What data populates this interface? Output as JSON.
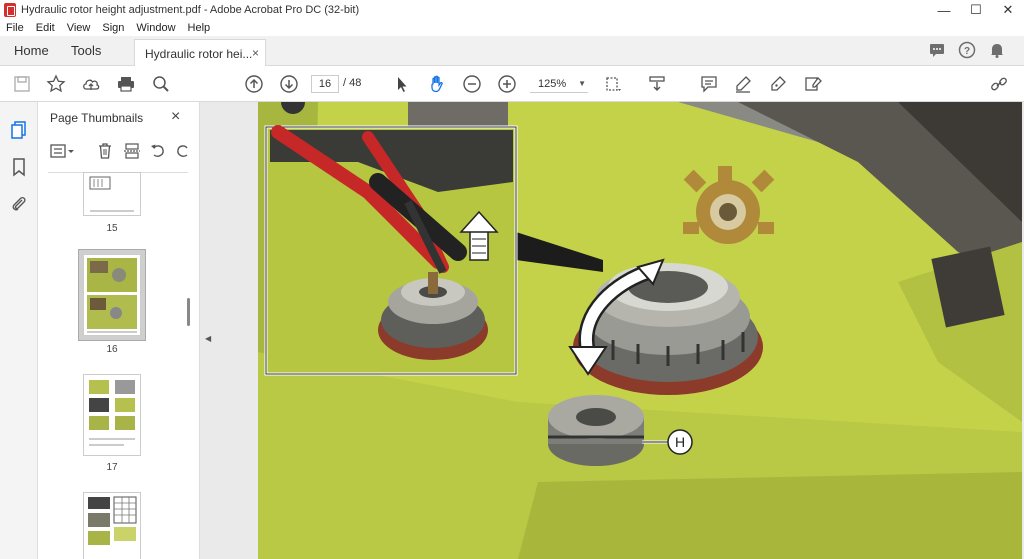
{
  "window": {
    "title": "Hydraulic rotor height adjustment.pdf - Adobe Acrobat Pro DC (32-bit)",
    "minimize": "—",
    "maximize": "☐",
    "close": "✕"
  },
  "menu": [
    "File",
    "Edit",
    "View",
    "Sign",
    "Window",
    "Help"
  ],
  "tabs": {
    "home": "Home",
    "tools": "Tools",
    "document": "Hydraulic rotor hei...",
    "close": "×"
  },
  "toolbar": {
    "page_current": "16",
    "page_total": "/ 48",
    "zoom": "125%",
    "zoom_caret": "▼"
  },
  "thumbnails": {
    "title": "Page Thumbnails",
    "close": "×",
    "pages": [
      "15",
      "16",
      "17"
    ]
  },
  "document": {
    "callout_label": "H"
  },
  "colors": {
    "accent_blue": "#1473e6",
    "icon_grey": "#6e6e6e",
    "page_green": "#c7d64a",
    "callout_border": "#333333"
  }
}
